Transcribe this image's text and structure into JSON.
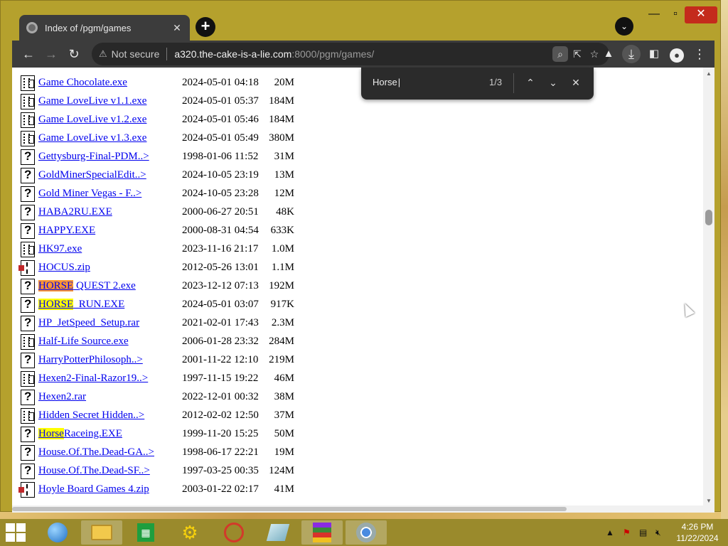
{
  "browser": {
    "tab_title": "Index of /pgm/games",
    "tab_close": "✕",
    "new_tab": "+",
    "tab_search": "⌄",
    "window_controls": {
      "minimize": "—",
      "maximize": "▫",
      "close": "✕"
    }
  },
  "toolbar": {
    "back": "←",
    "forward": "→",
    "reload": "↻",
    "security_label": "Not secure",
    "url_host": "a320.the-cake-is-a-lie.com",
    "url_rest": ":8000/pgm/games/",
    "icons": [
      "find-in-page-icon",
      "share-icon",
      "bookmark-star-icon",
      "labs-flask-icon",
      "download-icon",
      "side-panel-icon",
      "profile-icon",
      "menu-icon"
    ]
  },
  "find_bar": {
    "query": "Horse",
    "count": "1/3",
    "prev": "⌃",
    "next": "⌄",
    "close": "✕"
  },
  "listing": [
    {
      "icon": "exe",
      "name": "Game Chocolate.exe",
      "date": "2024-05-01 04:18",
      "size": "20M"
    },
    {
      "icon": "exe",
      "name": "Game LoveLive v1.1.exe",
      "date": "2024-05-01 05:37",
      "size": "184M"
    },
    {
      "icon": "exe",
      "name": "Game LoveLive v1.2.exe",
      "date": "2024-05-01 05:46",
      "size": "184M"
    },
    {
      "icon": "exe",
      "name": "Game LoveLive v1.3.exe",
      "date": "2024-05-01 05:49",
      "size": "380M"
    },
    {
      "icon": "q",
      "name": "Gettysburg-Final-PDM..>",
      "date": "1998-01-06 11:52",
      "size": "31M"
    },
    {
      "icon": "q",
      "name": "GoldMinerSpecialEdit..>",
      "date": "2024-10-05 23:19",
      "size": "13M"
    },
    {
      "icon": "q",
      "name": "Gold Miner Vegas - F..>",
      "date": "2024-10-05 23:28",
      "size": "12M"
    },
    {
      "icon": "q",
      "name": "HABA2RU.EXE",
      "date": "2000-06-27 20:51",
      "size": "48K"
    },
    {
      "icon": "q",
      "name": "HAPPY.EXE",
      "date": "2000-08-31 04:54",
      "size": "633K"
    },
    {
      "icon": "exe",
      "name": "HK97.exe",
      "date": "2023-11-16 21:17",
      "size": "1.0M"
    },
    {
      "icon": "zip",
      "name": "HOCUS.zip",
      "date": "2012-05-26 13:01",
      "size": "1.1M"
    },
    {
      "icon": "q",
      "hl": "HORSE",
      "hl_current": true,
      "name": " QUEST 2.exe",
      "date": "2023-12-12 07:13",
      "size": "192M"
    },
    {
      "icon": "q",
      "hl": "HORSE",
      "name": "_RUN.EXE",
      "date": "2024-05-01 03:07",
      "size": "917K"
    },
    {
      "icon": "q",
      "name": "HP_JetSpeed_Setup.rar",
      "date": "2021-02-01 17:43",
      "size": "2.3M"
    },
    {
      "icon": "exe",
      "name": "Half-Life Source.exe",
      "date": "2006-01-28 23:32",
      "size": "284M"
    },
    {
      "icon": "q",
      "name": "HarryPotterPhilosoph..>",
      "date": "2001-11-22 12:10",
      "size": "219M"
    },
    {
      "icon": "exe",
      "name": "Hexen2-Final-Razor19..>",
      "date": "1997-11-15 19:22",
      "size": "46M"
    },
    {
      "icon": "q",
      "name": "Hexen2.rar",
      "date": "2022-12-01 00:32",
      "size": "38M"
    },
    {
      "icon": "exe",
      "name": "Hidden Secret Hidden..>",
      "date": "2012-02-02 12:50",
      "size": "37M"
    },
    {
      "icon": "q",
      "hl": "Horse",
      "name": "Raceing.EXE",
      "date": "1999-11-20 15:25",
      "size": "50M"
    },
    {
      "icon": "q",
      "name": "House.Of.The.Dead-GA..>",
      "date": "1998-06-17 22:21",
      "size": "19M"
    },
    {
      "icon": "q",
      "name": "House.Of.The.Dead-SF..>",
      "date": "1997-03-25 00:35",
      "size": "124M"
    },
    {
      "icon": "zip",
      "name": "Hoyle Board Games 4.zip",
      "date": "2003-01-22 02:17",
      "size": "41M"
    }
  ],
  "taskbar": {
    "apps": [
      "internet-explorer-icon",
      "file-explorer-icon",
      "store-icon",
      "app-yellow-icon",
      "app-red-icon",
      "notepad-icon",
      "winrar-icon",
      "chrome-icon"
    ],
    "clock_time": "4:26 PM",
    "clock_date": "11/22/2024"
  },
  "colors": {
    "window_frame": "#b5a12d",
    "toolbar": "#3c3c3c",
    "link": "#0000ee",
    "highlight": "#ffff00",
    "highlight_current": "#ff9632"
  }
}
